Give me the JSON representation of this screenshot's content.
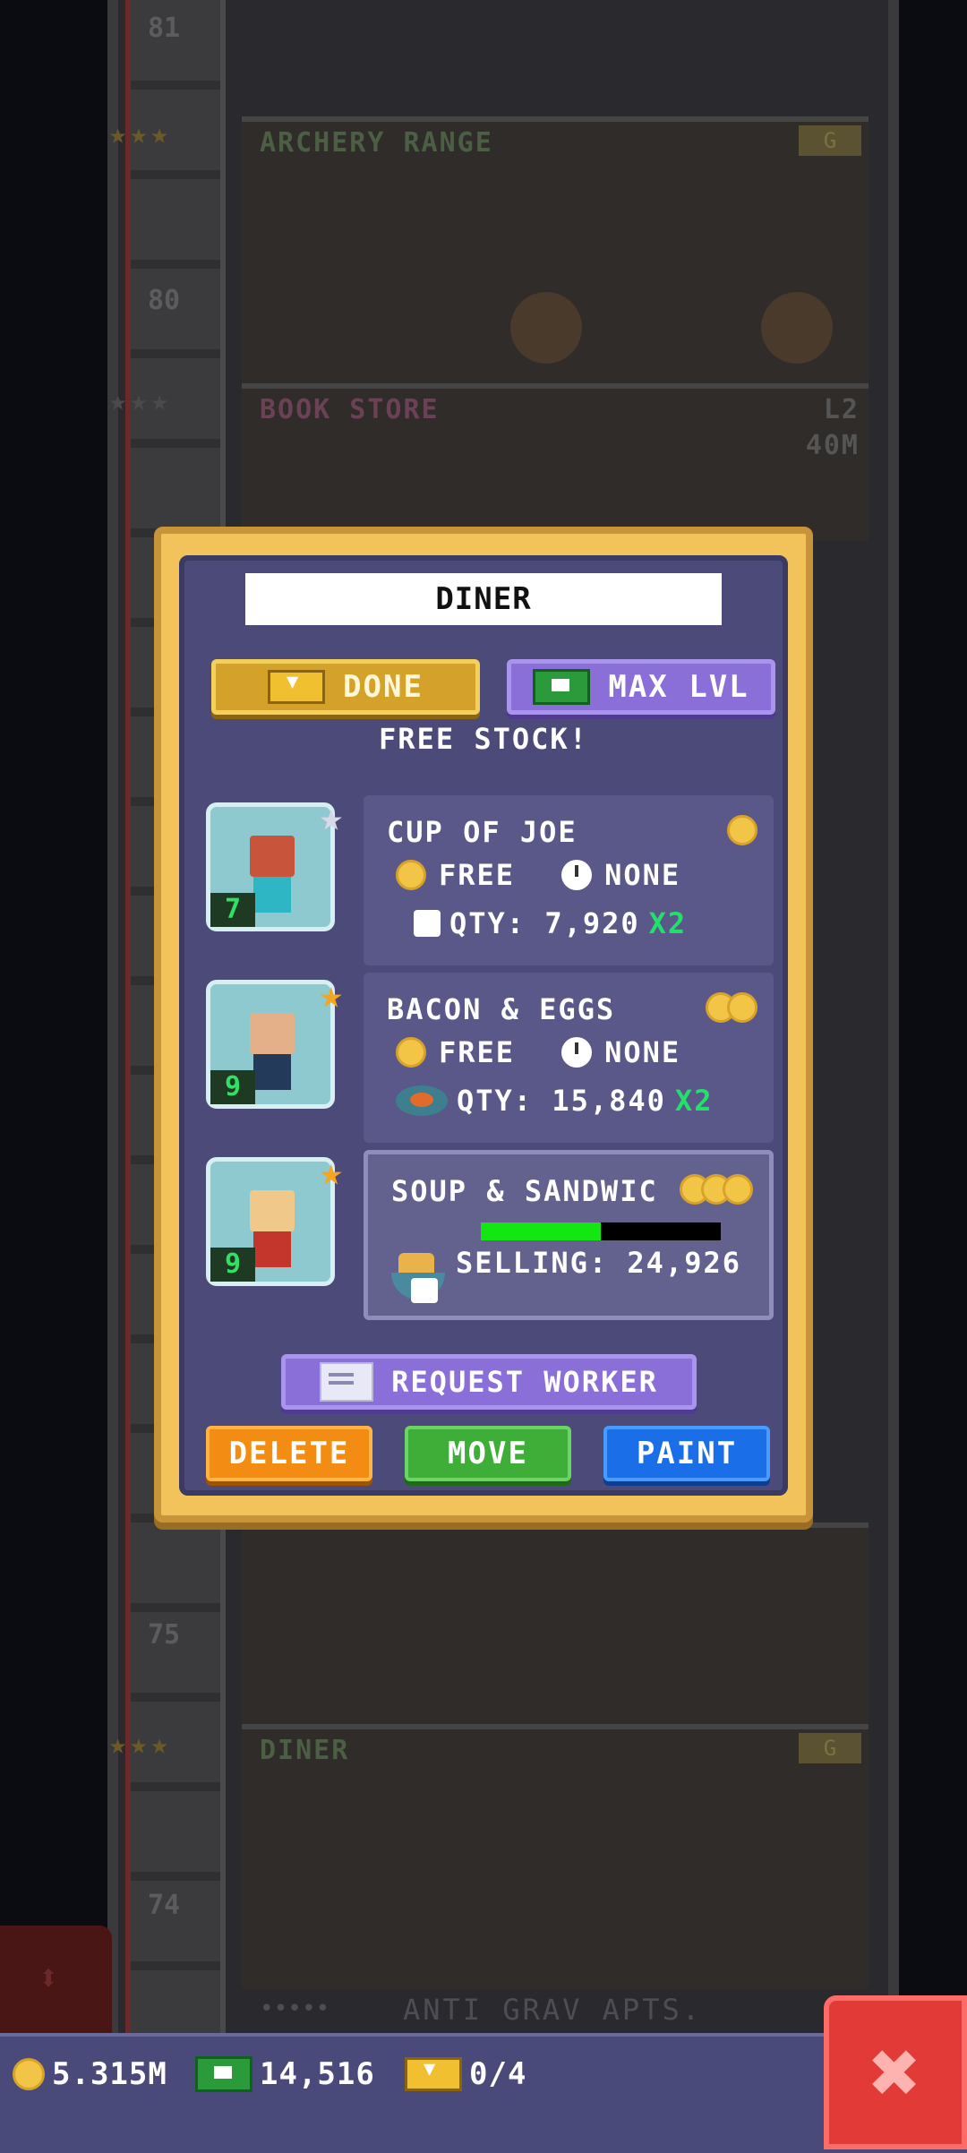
{
  "tower": {
    "floor_numbers": [
      "81",
      "80",
      "75",
      "74"
    ],
    "floors": [
      {
        "name": "ARCHERY RANGE",
        "badge": "G"
      },
      {
        "name": "BOOK STORE",
        "level": "L2",
        "value": "40M"
      },
      {
        "name": "DINER",
        "badge": "G"
      },
      {
        "name": "ANTI GRAV APTS."
      }
    ]
  },
  "modal": {
    "title": "DINER",
    "done_label": "DONE",
    "max_lvl_label": "MAX LVL",
    "free_stock": "FREE STOCK!",
    "workers": [
      {
        "level": "7",
        "star": "silver"
      },
      {
        "level": "9",
        "star": "gold"
      },
      {
        "level": "9",
        "star": "gold"
      }
    ],
    "products": [
      {
        "name": "CUP OF JOE",
        "price": "FREE",
        "time": "NONE",
        "qty": "QTY: 7,920",
        "multiplier": "X2",
        "coins": 1
      },
      {
        "name": "BACON & EGGS",
        "price": "FREE",
        "time": "NONE",
        "qty": "QTY: 15,840",
        "multiplier": "X2",
        "coins": 2
      },
      {
        "name": "SOUP & SANDWIC",
        "selling": "SELLING: 24,926",
        "progress": 0.5,
        "coins": 3
      }
    ],
    "request_worker_label": "REQUEST WORKER",
    "delete_label": "DELETE",
    "move_label": "MOVE",
    "paint_label": "PAINT"
  },
  "bottom_bar": {
    "coins": "5.315M",
    "bux": "14,516",
    "tickets": "0/4",
    "close_icon": "close-icon"
  },
  "colors": {
    "modal_gold": "#f1c35a",
    "modal_panel": "#4b4a79",
    "delete": "#f28c12",
    "move": "#3fae39",
    "paint": "#1a6fe8",
    "close": "#e23a36"
  }
}
